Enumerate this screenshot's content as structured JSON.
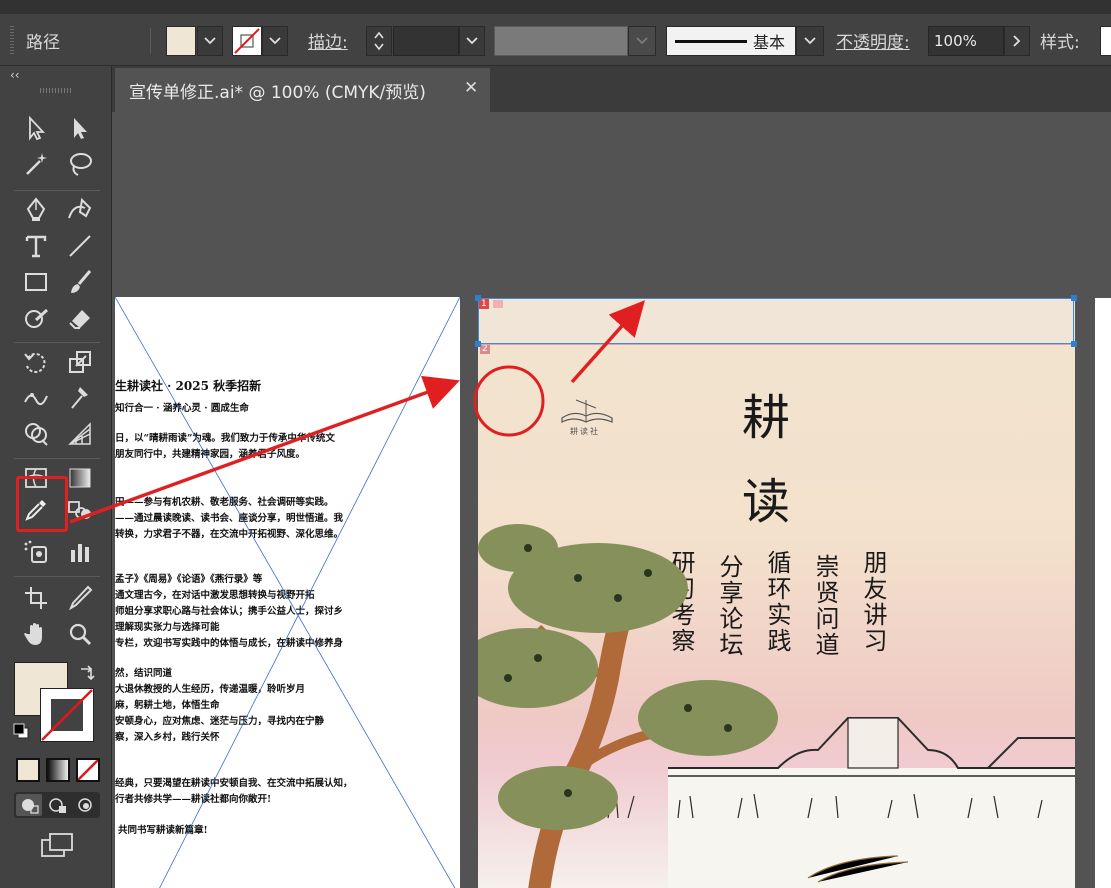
{
  "control_bar": {
    "object_type": "路径",
    "stroke_label": "描边",
    "stroke_value": "",
    "stroke_profile": "基本",
    "opacity_label": "不透明度",
    "opacity_value": "100%",
    "style_label": "样式",
    "colon": ":"
  },
  "document_tab": {
    "title": "宣传单修正.ai* @ 100% (CMYK/预览)",
    "close": "✕"
  },
  "toolbar": {
    "collapse": "‹‹",
    "tools": [
      "selection-tool",
      "direct-selection-tool",
      "magic-wand-tool",
      "lasso-tool",
      "pen-tool",
      "curvature-tool",
      "type-tool",
      "line-segment-tool",
      "rectangle-tool",
      "paintbrush-tool",
      "shaper-tool",
      "eraser-tool",
      "rotate-tool",
      "scale-tool",
      "width-tool",
      "puppet-warp-tool",
      "shape-builder-tool",
      "perspective-grid-tool",
      "mesh-tool",
      "gradient-tool",
      "eyedropper-tool",
      "blend-tool",
      "symbol-sprayer-tool",
      "column-graph-tool",
      "artboard-tool",
      "slice-tool",
      "hand-tool",
      "zoom-tool"
    ],
    "fill_color": "#f0e6d6",
    "highlighted_tool": "eyedropper-tool"
  },
  "left_page": {
    "lines": [
      "生耕读社 · 2025 秋季招新",
      "知行合一 · 涵养心灵 · 圆成生命",
      "日，以“晴耕雨读”为魂。我们致力于传承中华传统文",
      "朋友同行中，共建精神家园，涵养君子风度。",
      "田——参与有机农耕、敬老服务、社会调研等实践。",
      "——通过晨读晚读、读书会、座谈分享，明世悟道。我",
      "转换，力求君子不器，在交流中开拓视野、深化思维。",
      "孟子》《周易》《论语》《燕行录》等",
      "通文理古今，在对话中激发思想转换与视野开拓",
      "师姐分享求职心路与社会体认；携手公益人士，探讨乡",
      "理解现实张力与选择可能",
      "专栏，欢迎书写实践中的体悟与成长，在耕读中修养身",
      "然，结识同道",
      "大退休教授的人生经历，传递温暖，聆听岁月",
      "麻，躬耕土地，体悟生命",
      "安顿身心，应对焦虑、迷茫与压力，寻找内在宁静",
      "察，深入乡村，践行关怀",
      "经典，只要渴望在耕读中安顿自我、在交流中拓展认知，",
      "行者共修共学——耕读社都向你敞开!",
      "共同书写耕读新篇章!"
    ]
  },
  "right_page": {
    "artboard_num_1": "1",
    "artboard_num_2": "2",
    "logo_text": "耕读社",
    "title_chars": [
      "耕",
      "读"
    ],
    "columns": [
      "朋友讲习",
      "崇贤问道",
      "循环实践",
      "分享论坛",
      "研习考察"
    ]
  },
  "colors": {
    "accent_red": "#e02020",
    "selection_blue": "#2f7fd0",
    "panel": "#424242",
    "canvas": "#535353"
  }
}
